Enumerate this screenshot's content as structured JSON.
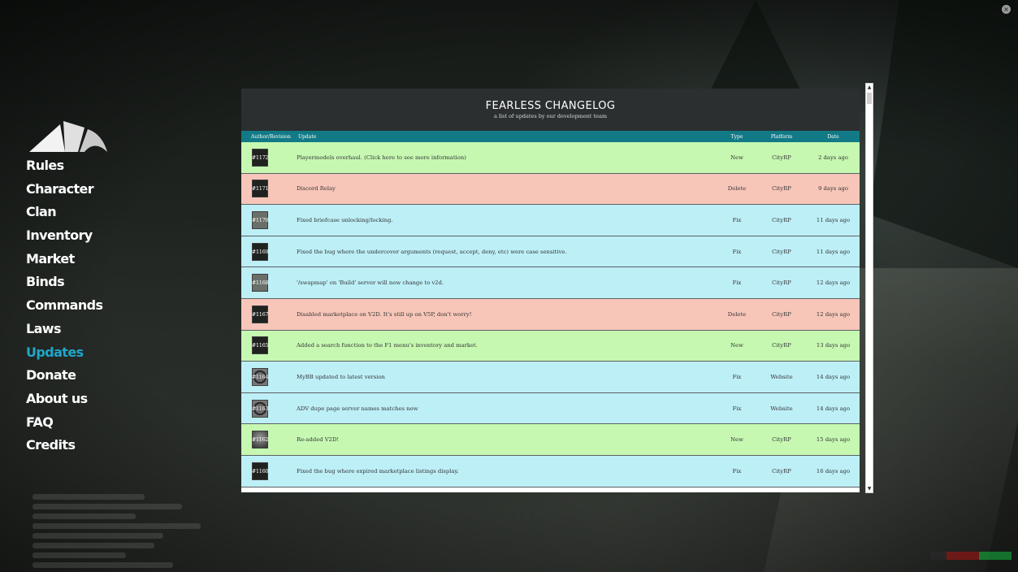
{
  "sidebar": {
    "items": [
      {
        "label": "Rules"
      },
      {
        "label": "Character"
      },
      {
        "label": "Clan"
      },
      {
        "label": "Inventory"
      },
      {
        "label": "Market"
      },
      {
        "label": "Binds"
      },
      {
        "label": "Commands"
      },
      {
        "label": "Laws"
      },
      {
        "label": "Updates",
        "active": true
      },
      {
        "label": "Donate"
      },
      {
        "label": "About us"
      },
      {
        "label": "FAQ"
      },
      {
        "label": "Credits"
      }
    ]
  },
  "changelog": {
    "title": "FEARLESS CHANGELOG",
    "subtitle": "a list of updates by our development team",
    "columns": {
      "author": "Author/Revision",
      "update": "Update",
      "type": "Type",
      "platform": "Platform",
      "date": "Date"
    },
    "rows": [
      {
        "rev": "#1172",
        "update": "Playermodels overhaul. (Click here to see more information)",
        "type": "New",
        "platform": "CityRP",
        "date": "2 days ago"
      },
      {
        "rev": "#1171",
        "update": "Discord Relay",
        "type": "Delete",
        "platform": "CityRP",
        "date": "9 days ago"
      },
      {
        "rev": "#1170",
        "update": "Fixed briefcase unlocking/locking.",
        "type": "Fix",
        "platform": "CityRP",
        "date": "11 days ago"
      },
      {
        "rev": "#1169",
        "update": "Fixed the bug where the undercover arguments (request, accept, deny, etc) were case sensitive.",
        "type": "Fix",
        "platform": "CityRP",
        "date": "11 days ago"
      },
      {
        "rev": "#1168",
        "update": "'/swapmap' on 'Build' server will now change to v2d.",
        "type": "Fix",
        "platform": "CityRP",
        "date": "12 days ago"
      },
      {
        "rev": "#1167",
        "update": "Disabled marketplace on V2D. It's still up on V5P, don't worry!",
        "type": "Delete",
        "platform": "CityRP",
        "date": "12 days ago"
      },
      {
        "rev": "#1165",
        "update": "Added a search function to the F1 menu's inventory and market.",
        "type": "New",
        "platform": "CityRP",
        "date": "13 days ago"
      },
      {
        "rev": "#1164",
        "update": "MyBB updated to latest version",
        "type": "Fix",
        "platform": "Website",
        "date": "14 days ago"
      },
      {
        "rev": "#1163",
        "update": "ADV dupe page server names matches now",
        "type": "Fix",
        "platform": "Website",
        "date": "14 days ago"
      },
      {
        "rev": "#1162",
        "update": "Re-added V2D!",
        "type": "New",
        "platform": "CityRP",
        "date": "15 days ago"
      },
      {
        "rev": "#1160",
        "update": "Fixed the bug where expired marketplace listings display.",
        "type": "Fix",
        "platform": "CityRP",
        "date": "16 days ago"
      }
    ]
  },
  "colors": {
    "accent_active": "#1fa7c9",
    "header_bg": "#2b2f30",
    "column_header_bg": "#117a86",
    "row_new": "#c6f8b2",
    "row_delete": "#f7c6b9",
    "row_fix": "#bdeff7"
  },
  "icons": {
    "logo": "fearless-wing-logo-icon",
    "close": "close-icon",
    "scroll_up": "chevron-up-icon",
    "scroll_down": "chevron-down-icon"
  }
}
